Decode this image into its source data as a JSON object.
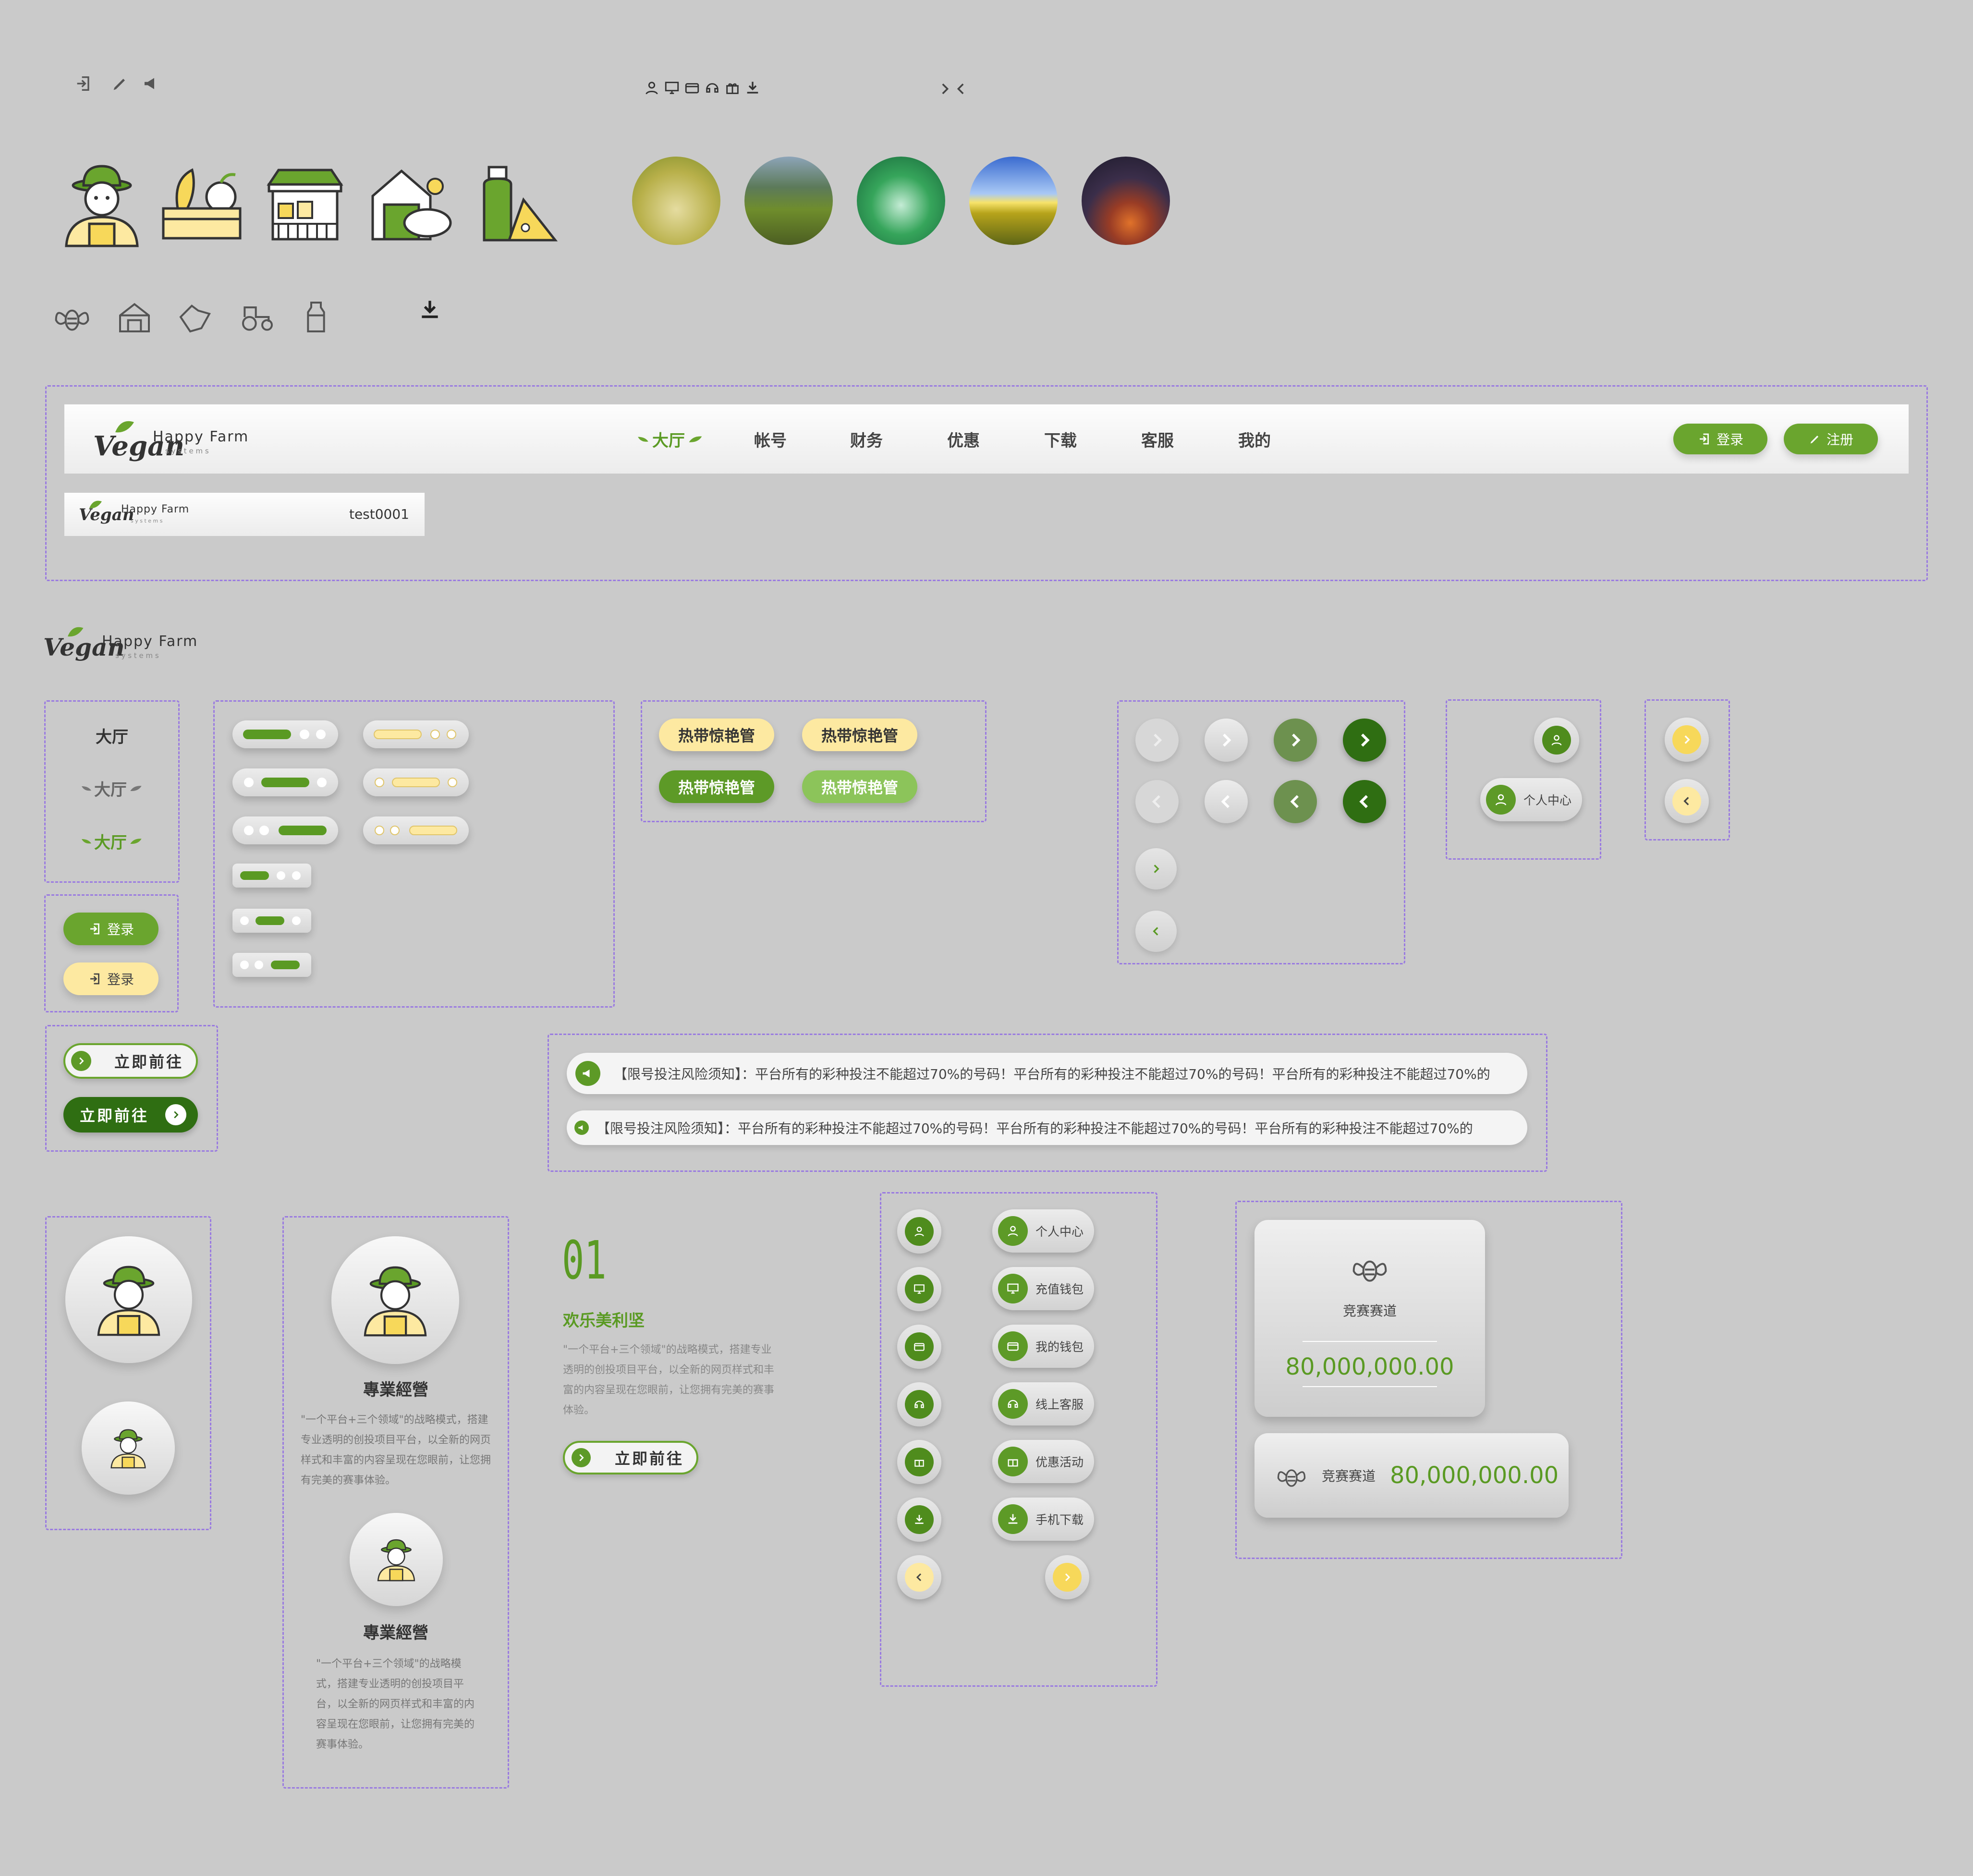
{
  "colors": {
    "green": "#6aa52e",
    "dark_green": "#2f6e12",
    "yellow": "#fde9a1",
    "bg": "#cacaca"
  },
  "brand": {
    "logo_script": "Vegan",
    "logo_name": "Happy Farm",
    "logo_sub": "s y s t e m s"
  },
  "nav": {
    "items": [
      "大厅",
      "帐号",
      "财务",
      "优惠",
      "下载",
      "客服",
      "我的"
    ],
    "login": "登录",
    "register": "注册"
  },
  "mini_header": {
    "username": "test0001"
  },
  "nav_states": [
    "大厅",
    "大厅",
    "大厅"
  ],
  "login_buttons": [
    "登录",
    "登录"
  ],
  "go_buttons": [
    "立即前往",
    "立即前往"
  ],
  "tags": [
    "热带惊艳管",
    "热带惊艳管",
    "热带惊艳管",
    "热带惊艳管"
  ],
  "personal_center": "个人中心",
  "notices": [
    "【限号投注风险须知】：平台所有的彩种投注不能超过70%的号码！平台所有的彩种投注不能超过70%的号码！平台所有的彩种投注不能超过70%的",
    "【限号投注风险须知】：平台所有的彩种投注不能超过70%的号码！平台所有的彩种投注不能超过70%的号码！平台所有的彩种投注不能超过70%的"
  ],
  "cards": [
    {
      "title": "專業經營",
      "text": "\"一个平台+三个领域\"的战略模式，搭建专业透明的创投项目平台，以全新的网页样式和丰富的内容呈现在您眼前，让您拥有完美的赛事体验。"
    },
    {
      "title": "專業經營",
      "text": "\"一个平台+三个领域\"的战略模式，搭建专业透明的创投项目平台，以全新的网页样式和丰富的内容呈现在您眼前，让您拥有完美的赛事体验。"
    }
  ],
  "feature": {
    "number": "01",
    "title": "欢乐美利坚",
    "text": "\"一个平台+三个领域\"的战略模式，搭建专业透明的创投项目平台，以全新的网页样式和丰富的内容呈现在您眼前，让您拥有完美的赛事体验。",
    "button": "立即前往"
  },
  "side_menu": [
    "个人中心",
    "充值钱包",
    "我的钱包",
    "线上客服",
    "优惠活动",
    "手机下载"
  ],
  "side_icons": [
    "user-icon",
    "wallet-charge-icon",
    "wallet-icon",
    "headset-icon",
    "gift-icon",
    "download-icon"
  ],
  "stats": {
    "label": "竞赛赛道",
    "value": "80,000,000.00",
    "label2": "竞赛赛道",
    "value2": "80,000,000.00"
  }
}
